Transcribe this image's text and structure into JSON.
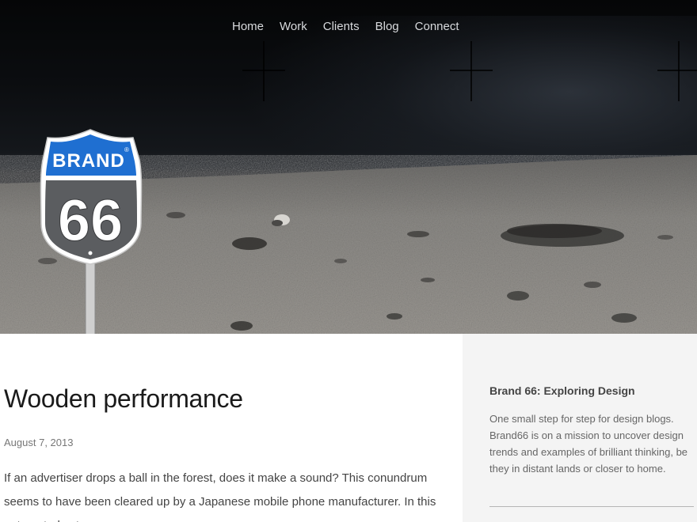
{
  "nav": {
    "items": [
      {
        "label": "Home"
      },
      {
        "label": "Work"
      },
      {
        "label": "Clients"
      },
      {
        "label": "Blog"
      },
      {
        "label": "Connect"
      }
    ]
  },
  "logo": {
    "top_text": "BRAND",
    "number": "66",
    "registered": "®"
  },
  "post": {
    "title": "Wooden performance",
    "date": "August 7, 2013",
    "body": "If an advertiser drops a ball in the forest, does it make a sound? This conundrum seems to have been cleared up by a Japanese mobile phone manufacturer. In this automated extravaganza, a"
  },
  "sidebar": {
    "title": "Brand 66: Exploring Design",
    "text": "One small step for step for design blogs. Brand66 is on a mission to uncover design trends and examples of brilliant thinking, be they in distant lands or closer to home."
  },
  "colors": {
    "sign_blue": "#1f6fd1",
    "sign_grey": "#5b5d60",
    "sidebar_bg": "#f4f4f4"
  }
}
